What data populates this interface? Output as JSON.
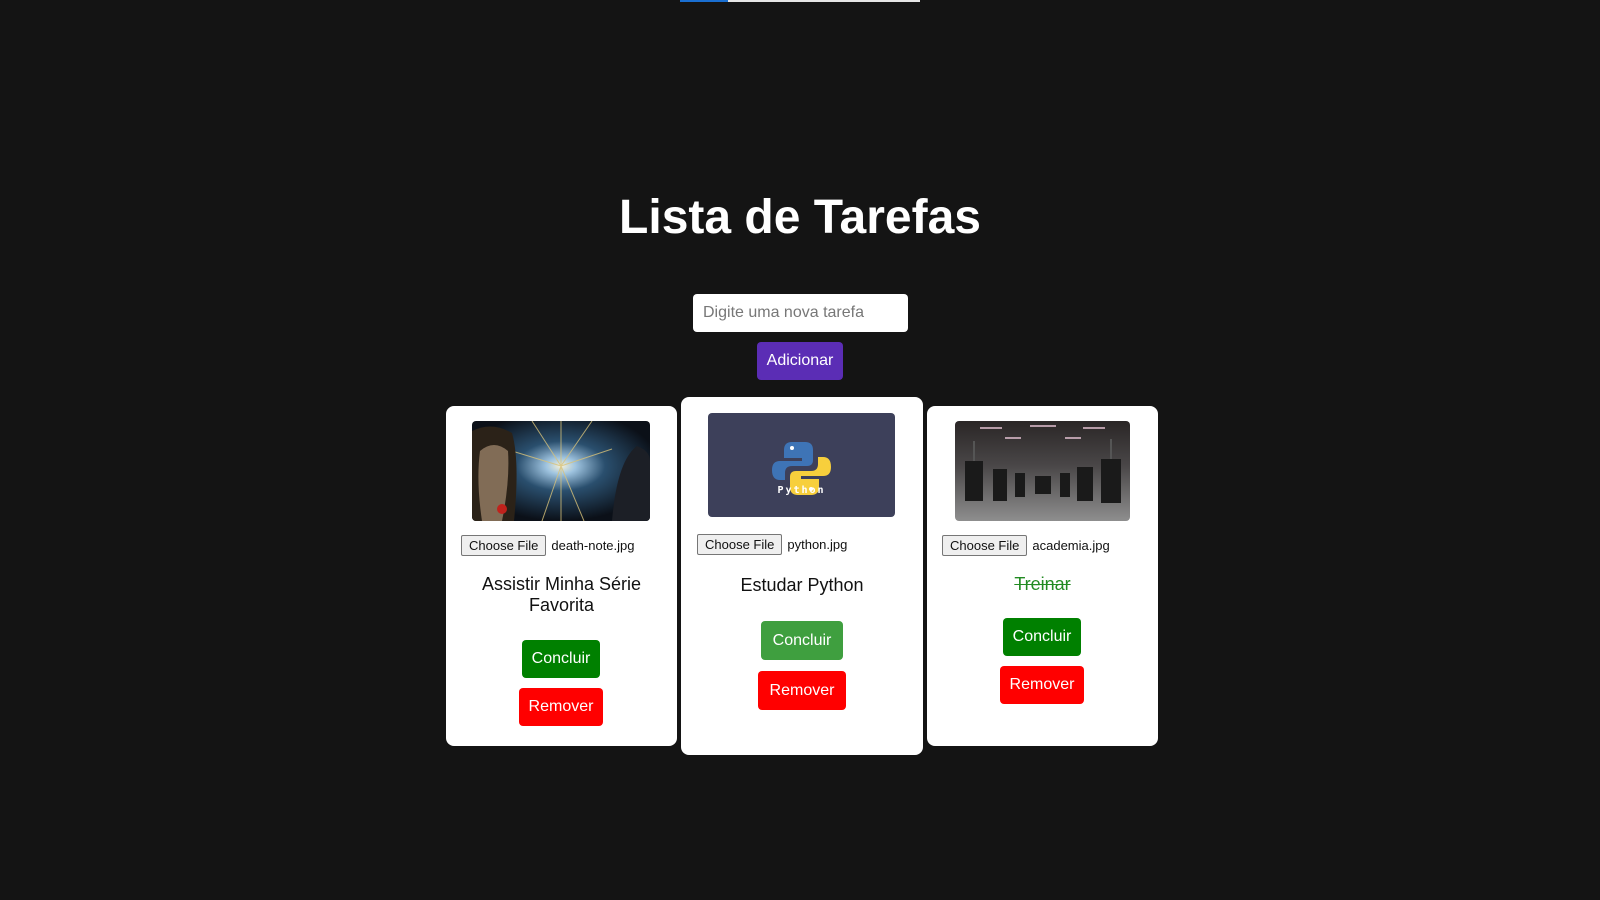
{
  "header": {
    "title": "Lista de Tarefas"
  },
  "form": {
    "placeholder": "Digite uma nova tarefa",
    "value": "",
    "add_label": "Adicionar"
  },
  "tasks": [
    {
      "text": "Assistir Minha Série Favorita",
      "file_button": "Choose File",
      "file_name": "death-note.jpg",
      "done": false,
      "complete_label": "Concluir",
      "remove_label": "Remover"
    },
    {
      "text": "Estudar Python",
      "file_button": "Choose File",
      "file_name": "python.jpg",
      "done": false,
      "complete_label": "Concluir",
      "remove_label": "Remover",
      "image_label": "Python"
    },
    {
      "text": "Treinar",
      "file_button": "Choose File",
      "file_name": "academia.jpg",
      "done": true,
      "complete_label": "Concluir",
      "remove_label": "Remover"
    }
  ],
  "colors": {
    "background": "#141414",
    "add_button": "#5b2db5",
    "complete_button": "#008000",
    "remove_button": "#ff0000",
    "done_text": "#228b22"
  }
}
